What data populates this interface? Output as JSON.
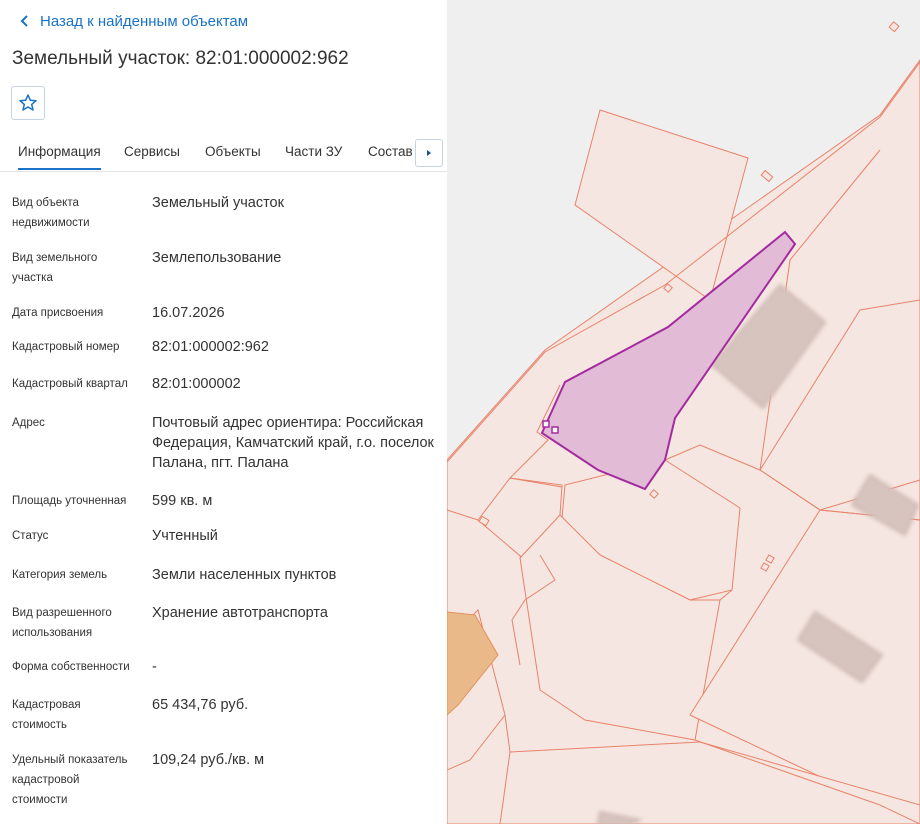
{
  "back_link": {
    "label": "Назад к найденным объектам"
  },
  "title": "Земельный участок: 82:01:000002:962",
  "tabs": [
    {
      "label": "Информация",
      "active": true
    },
    {
      "label": "Сервисы",
      "active": false
    },
    {
      "label": "Объекты",
      "active": false
    },
    {
      "label": "Части ЗУ",
      "active": false
    },
    {
      "label": "Состав",
      "active": false
    }
  ],
  "info_rows": [
    {
      "label": "Вид объекта недвижимости",
      "value": "Земельный участок"
    },
    {
      "label": "Вид земельного участка",
      "value": "Землепользование"
    },
    {
      "label": "Дата присвоения",
      "value": "16.07.2026"
    },
    {
      "label": "Кадастровый номер",
      "value": "82:01:000002:962"
    },
    {
      "label": "Кадастровый квартал",
      "value": "82:01:000002"
    },
    {
      "label": "Адрес",
      "value": "Почтовый адрес ориентира: Российская Федерация, Камчатский край, г.о. поселок Палана, пгт. Палана"
    },
    {
      "label": "Площадь уточненная",
      "value": "599 кв. м"
    },
    {
      "label": "Статус",
      "value": "Учтенный"
    },
    {
      "label": "Категория земель",
      "value": "Земли населенных пунктов"
    },
    {
      "label": "Вид разрешенного использования",
      "value": "Хранение автотранспорта"
    },
    {
      "label": "Форма собственности",
      "value": "-"
    },
    {
      "label": "Кадастровая стоимость",
      "value": "65 434,76 руб."
    },
    {
      "label": "Удельный показатель кадастровой стоимости",
      "value": "109,24 руб./кв. м"
    }
  ],
  "colors": {
    "accent": "#1a73c8",
    "parcel_fill": "#f6e6e1",
    "parcel_stroke": "#e8826a",
    "selected_fill": "#e2bcd6",
    "selected_stroke": "#a42aa0",
    "building_fill": "#d8c4bf",
    "orange_parcel": "#e9b98a"
  },
  "icons": {
    "back": "chevron-left-icon",
    "favorite": "star-icon",
    "tabs_next": "caret-right-icon"
  }
}
